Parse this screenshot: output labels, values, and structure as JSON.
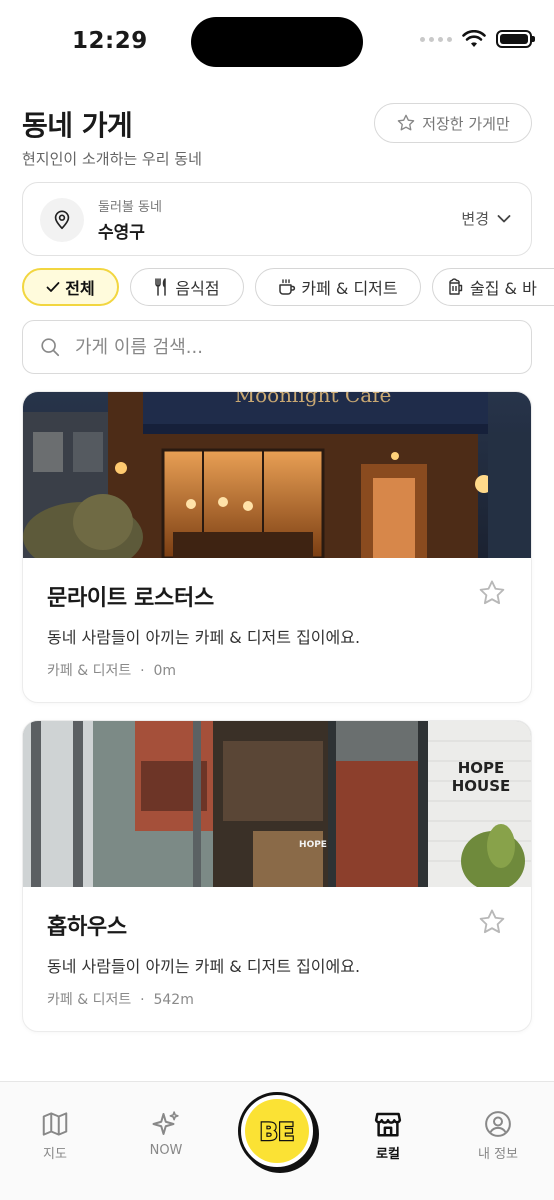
{
  "status_bar": {
    "time": "12:29"
  },
  "header": {
    "title": "동네 가게",
    "subtitle": "현지인이 소개하는 우리 동네",
    "saved_button_label": "저장한 가게만"
  },
  "location": {
    "label": "둘러볼 동네",
    "value": "수영구",
    "change_label": "변경"
  },
  "categories": [
    {
      "label": "전체",
      "icon": "check-icon",
      "selected": true
    },
    {
      "label": "음식점",
      "icon": "utensils-icon",
      "selected": false
    },
    {
      "label": "카페 & 디저트",
      "icon": "coffee-cup-icon",
      "selected": false
    },
    {
      "label": "술집 & 바",
      "icon": "beer-mug-icon",
      "selected": false
    }
  ],
  "search": {
    "placeholder": "가게 이름 검색...",
    "value": ""
  },
  "stores": [
    {
      "name": "문라이트 로스터스",
      "description": "동네 사람들이 아끼는 카페 & 디저트 집이에요.",
      "category": "카페 & 디저트",
      "distance": "0m",
      "sign_text": "Moonlight Cafe",
      "saved": false
    },
    {
      "name": "홉하우스",
      "description": "동네 사람들이 아끼는 카페 & 디저트 집이에요.",
      "category": "카페 & 디저트",
      "distance": "542m",
      "sign_text": "HOPE HOUSE",
      "saved": false
    }
  ],
  "bottom_nav": {
    "items": [
      {
        "label": "지도",
        "icon": "map-icon",
        "active": false
      },
      {
        "label": "NOW",
        "icon": "sparkle-icon",
        "active": false
      },
      {
        "label": "BE",
        "icon": "be-logo",
        "active": false
      },
      {
        "label": "로컬",
        "icon": "store-icon",
        "active": true
      },
      {
        "label": "내 정보",
        "icon": "user-icon",
        "active": false
      }
    ]
  },
  "colors": {
    "accent_yellow": "#fbe234",
    "chip_active_border": "#f2d640",
    "text_primary": "#1a1a1a",
    "text_secondary": "#666666"
  }
}
